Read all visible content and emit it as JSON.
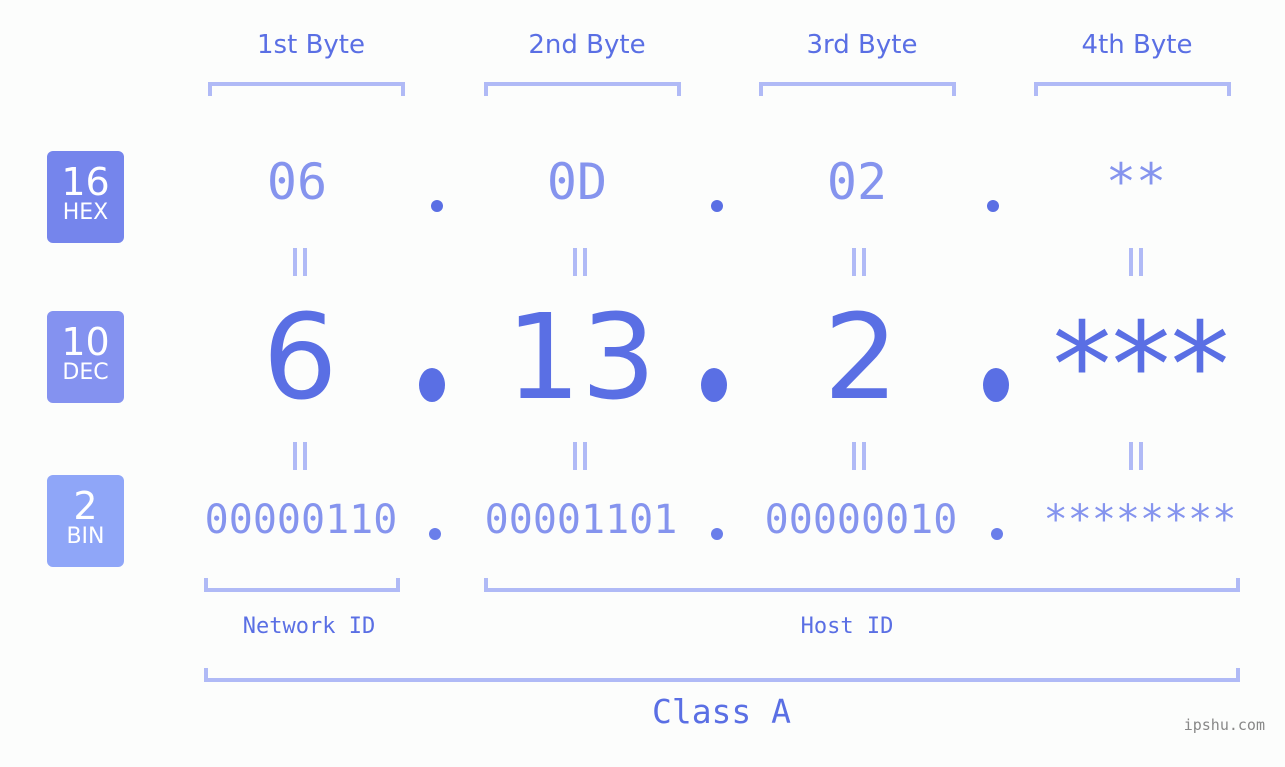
{
  "bytes": {
    "labels": [
      "1st Byte",
      "2nd Byte",
      "3rd Byte",
      "4th Byte"
    ]
  },
  "bases": {
    "hex": {
      "num": "16",
      "unit": "HEX",
      "color": "#7585ec"
    },
    "dec": {
      "num": "10",
      "unit": "DEC",
      "color": "#8492f0"
    },
    "bin": {
      "num": "2",
      "unit": "BIN",
      "color": "#8fa6f8"
    }
  },
  "values": {
    "hex": [
      "06",
      "0D",
      "02",
      "**"
    ],
    "dec": [
      "6",
      "13",
      "2",
      "***"
    ],
    "bin": [
      "00000110",
      "00001101",
      "00000010",
      "********"
    ]
  },
  "groups": {
    "network": "Network ID",
    "host": "Host ID",
    "class": "Class A"
  },
  "watermark": "ipshu.com",
  "colors": {
    "accent": "#5a6fe4",
    "light_accent": "#8594ee",
    "bracket": "#b0baf6",
    "background": "#fcfdfc"
  }
}
